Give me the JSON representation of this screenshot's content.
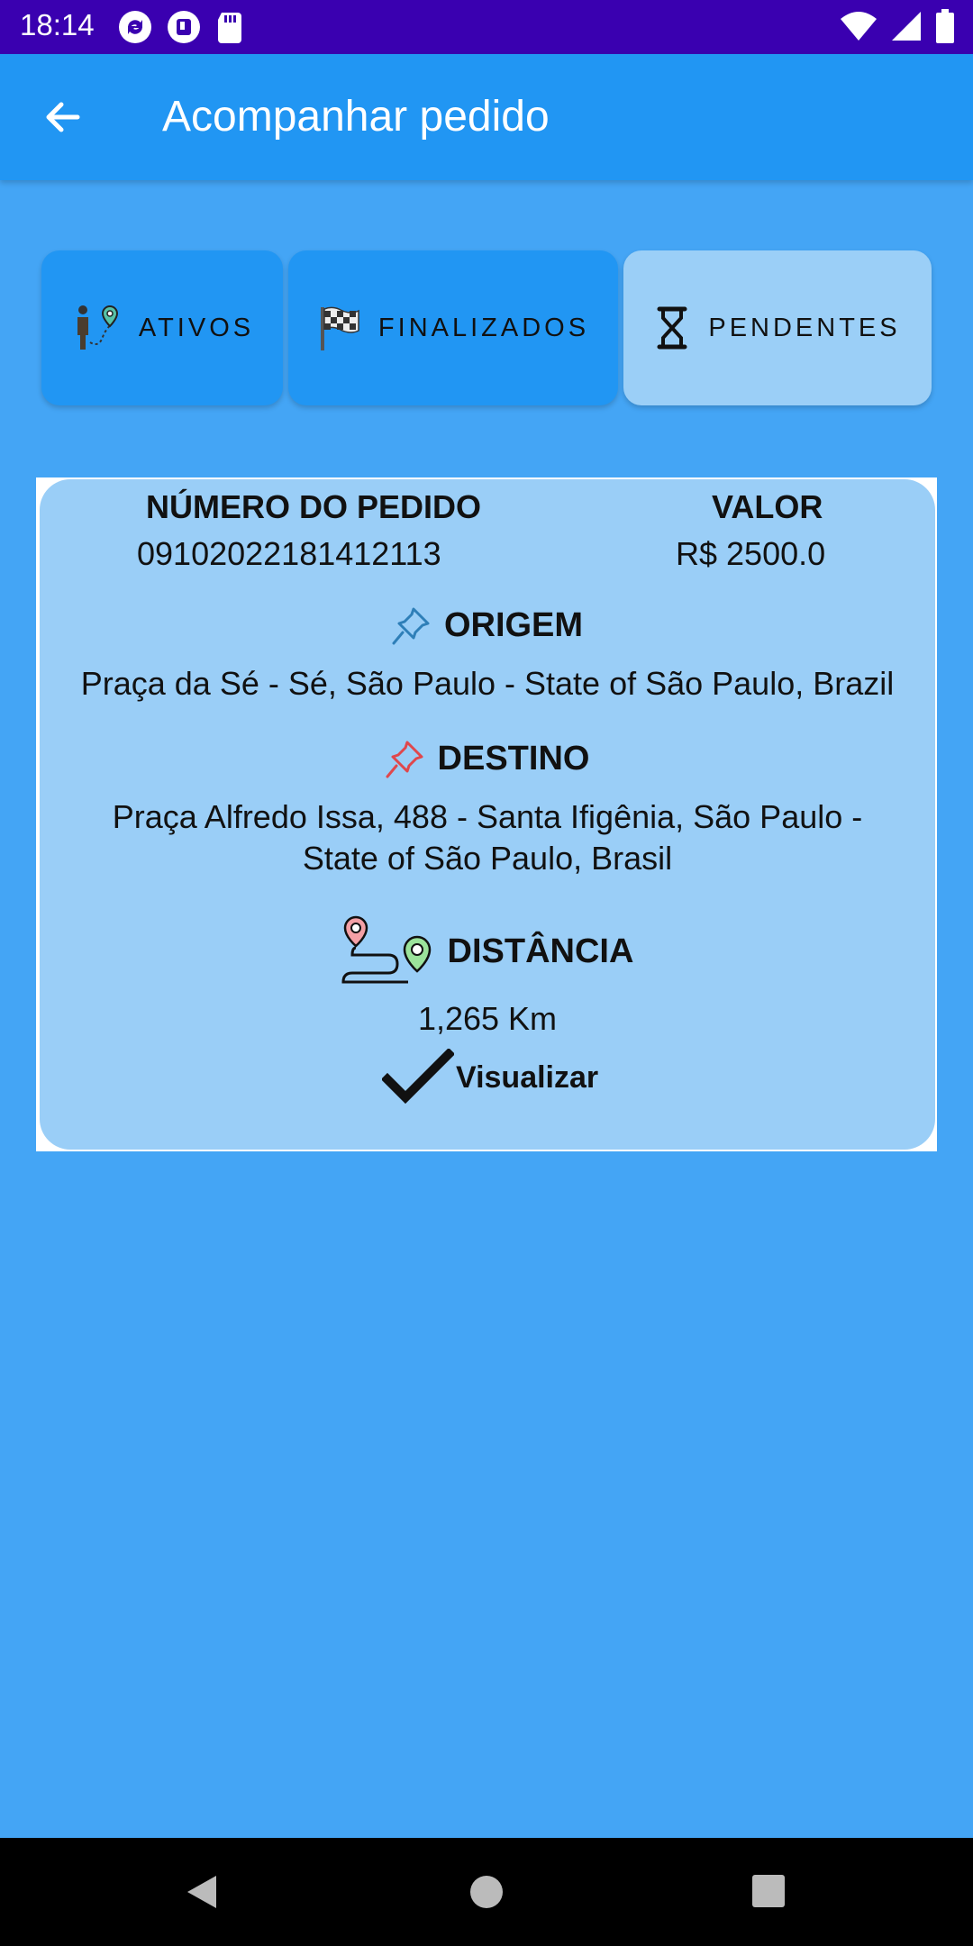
{
  "status_bar": {
    "time": "18:14"
  },
  "app_bar": {
    "title": "Acompanhar pedido"
  },
  "tabs": [
    {
      "label": "ATIVOS",
      "icon": "person-route-icon",
      "selected": false
    },
    {
      "label": "FINALIZADOS",
      "icon": "checkered-flag-icon",
      "selected": false
    },
    {
      "label": "PENDENTES",
      "icon": "hourglass-icon",
      "selected": true
    }
  ],
  "order": {
    "number_label": "NÚMERO DO PEDIDO",
    "number": "09102022181412113",
    "value_label": "VALOR",
    "value": "R$ 2500.0",
    "origin_label": "ORIGEM",
    "origin": "Praça da Sé - Sé, São Paulo - State of São Paulo, Brazil",
    "destination_label": "DESTINO",
    "destination_line1": "Praça Alfredo Issa, 488 - Santa Ifigênia, São Paulo -",
    "destination_line2": "State of São Paulo, Brasil",
    "distance_label": "DISTÂNCIA",
    "distance": "1,265 Km",
    "view_label": "Visualizar"
  },
  "colors": {
    "background": "#44A5F5",
    "app_bar": "#2196F3",
    "status_bar": "#3A00B0",
    "tab_selected": "#9BCFF7",
    "card": "#9ACEF7",
    "origin_pin": "#2E7FB8",
    "destination_pin": "#E0474C"
  }
}
